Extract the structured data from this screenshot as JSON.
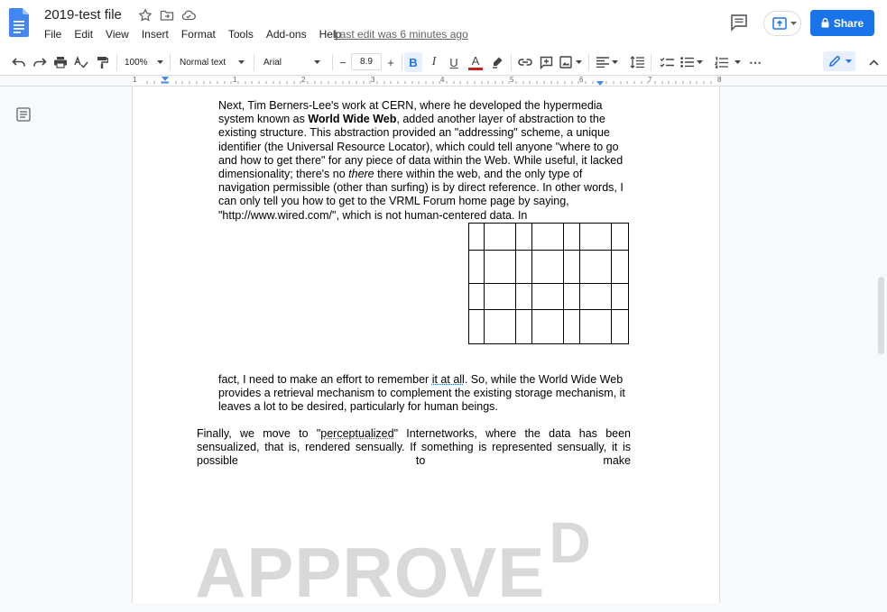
{
  "document": {
    "title": "2019-test file",
    "last_edit": "Last edit was 6 minutes ago"
  },
  "menu": [
    "File",
    "Edit",
    "View",
    "Insert",
    "Format",
    "Tools",
    "Add-ons",
    "Help"
  ],
  "share": {
    "label": "Share"
  },
  "toolbar": {
    "zoom": "100%",
    "style": "Normal text",
    "font": "Arial",
    "font_size": "8.9",
    "minus": "−",
    "plus": "+",
    "bold": "B",
    "italic": "I",
    "underline": "U",
    "text_color": "A",
    "more": "⋯"
  },
  "ruler": {
    "ticks": [
      "1",
      "1",
      "2",
      "3",
      "4",
      "5",
      "6",
      "7",
      "8"
    ]
  },
  "content": {
    "p1_a": "Next, Tim Berners-Lee's work at CERN, where he developed the hypermedia system known as ",
    "p1_bold": "World Wide Web",
    "p1_b": ", added another layer of abstraction to the existing structure. This abstraction provided an \"addressing\" scheme, a unique identifier (the Universal Resource Locator), which could tell anyone \"where to go and how to get there\" for any piece of data within the Web. While useful, it lacked dimensionality; there's no ",
    "p1_italic": "there",
    "p1_c": " there within the web, and the only type of navigation permissible (other than surfing) is by direct reference. In other words, I can only tell you how to get to the VRML Forum home page by saying, \"http://www.wired.com/\", which is not human-centered data. In",
    "p2_a": "fact, I need to make an effort to remember ",
    "p2_underlined": "it at all",
    "p2_b": ". So, while the World Wide Web provides a retrieval mechanism to complement the existing storage mechanism, it leaves a lot to be desired, particularly for human beings.",
    "p3_a": "Finally, we move to \"",
    "p3_underlined": "perceptualized",
    "p3_b": "\" Internetworks, where the data has been sensualized, that is, rendered sensually. If something is represented sensually, it is possible to make"
  },
  "watermark": {
    "main": "APPROVE",
    "sup": "D"
  },
  "colors": {
    "accent": "#1a73e8",
    "text_color_bar": "#c5221f"
  }
}
